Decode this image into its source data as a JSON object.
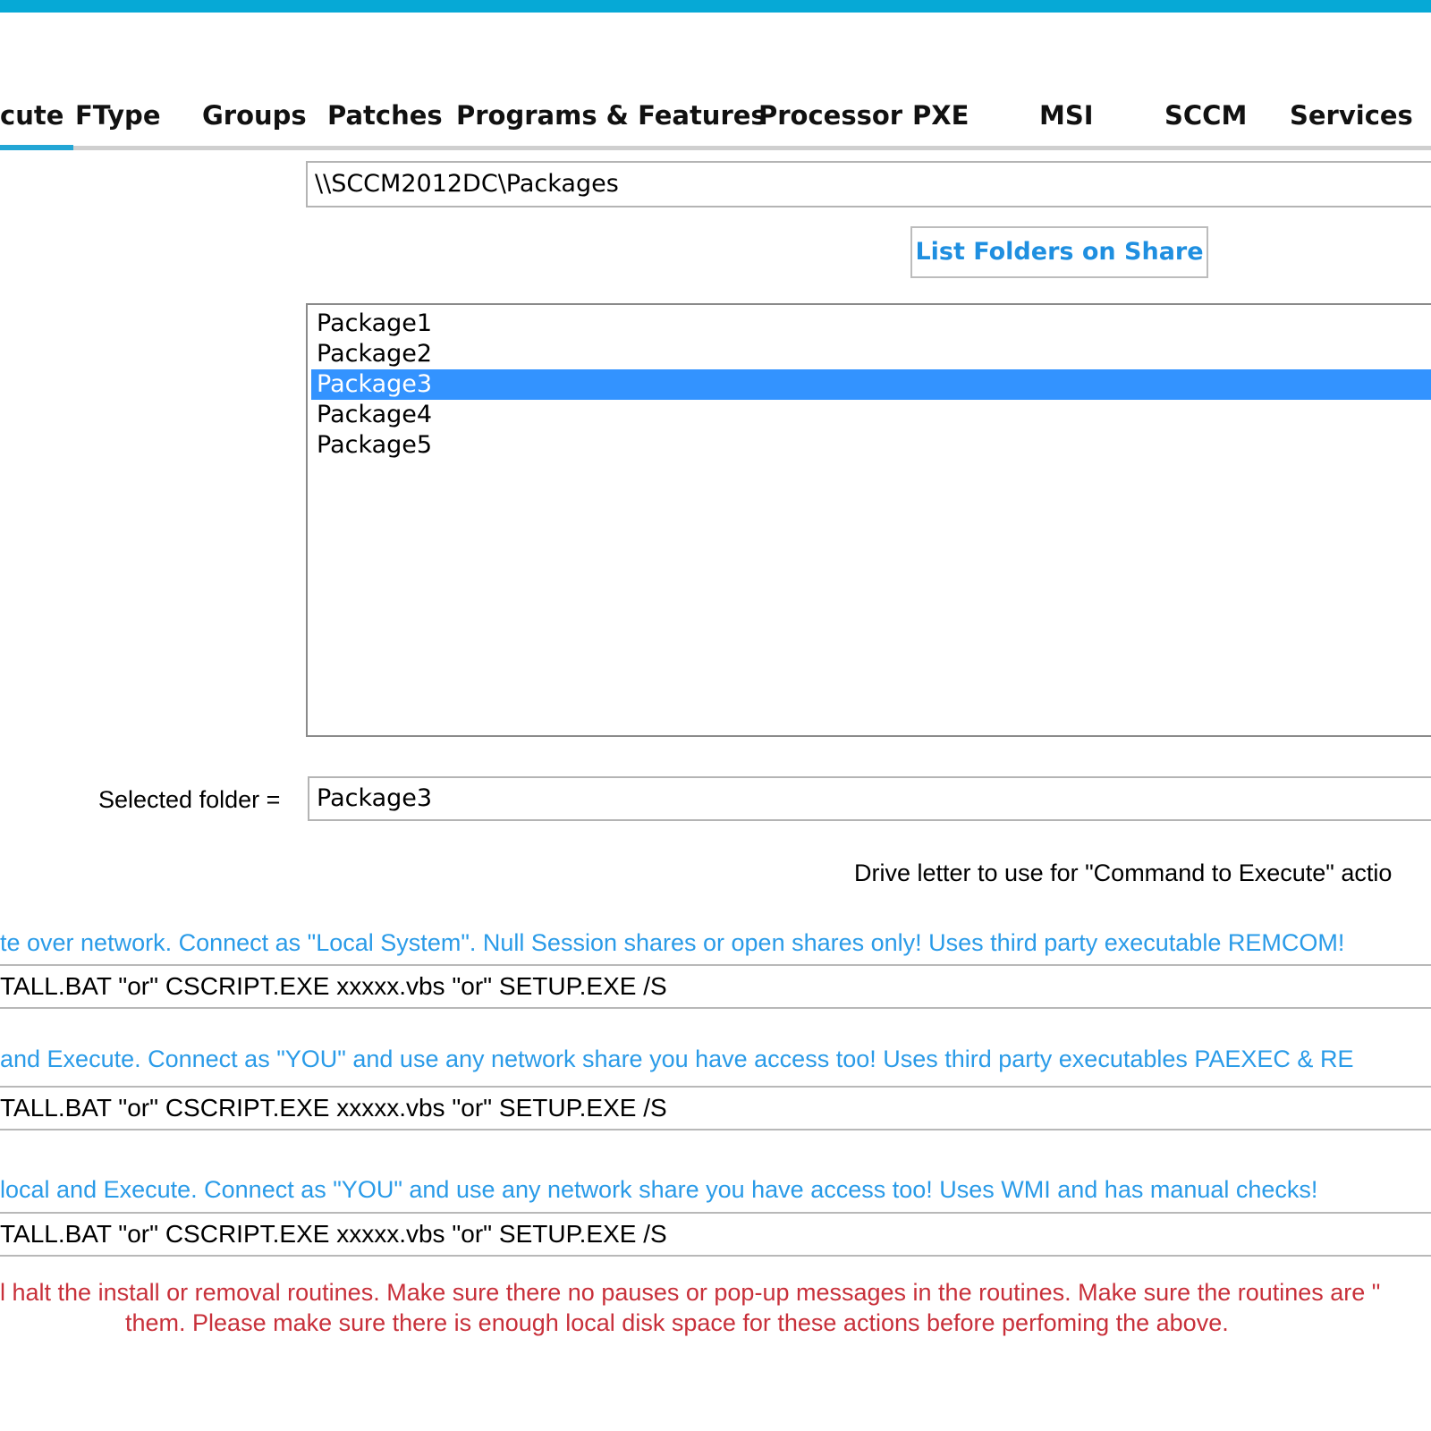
{
  "tabs": [
    {
      "label": "cute"
    },
    {
      "label": "FType"
    },
    {
      "label": "Groups"
    },
    {
      "label": "Patches"
    },
    {
      "label": "Programs & Features"
    },
    {
      "label": "Processor"
    },
    {
      "label": "PXE"
    },
    {
      "label": "MSI"
    },
    {
      "label": "SCCM"
    },
    {
      "label": "Services"
    }
  ],
  "share": {
    "path_value": "\\\\SCCM2012DC\\Packages",
    "list_button_label": "List Folders on Share"
  },
  "folders": {
    "items": [
      "Package1",
      "Package2",
      "Package3",
      "Package4",
      "Package5"
    ],
    "selected": "Package3"
  },
  "selected_folder": {
    "label": "Selected folder =",
    "value": "Package3"
  },
  "drive_letter_label": "Drive letter to use for \"Command to Execute\" actio",
  "methods": [
    {
      "note": "te over network. Connect as \"Local System\". Null Session shares or open shares only! Uses third party executable REMCOM!",
      "command": "TALL.BAT \"or\" CSCRIPT.EXE xxxxx.vbs \"or\" SETUP.EXE /S"
    },
    {
      "note": "and Execute. Connect as \"YOU\" and use any network share you have access too! Uses third party executables PAEXEC & RE",
      "command": "TALL.BAT \"or\" CSCRIPT.EXE xxxxx.vbs \"or\" SETUP.EXE /S"
    },
    {
      "note": "local and Execute. Connect as \"YOU\" and use any network share you have access too! Uses WMI and has manual checks!",
      "command": "TALL.BAT \"or\" CSCRIPT.EXE xxxxx.vbs \"or\" SETUP.EXE /S"
    }
  ],
  "warning": {
    "line1": "l halt the install or removal routines. Make sure there no pauses or pop-up messages in the routines. Make sure the routines are \"",
    "line2": "them. Please make sure there is enough local disk space for these actions before perfoming the above."
  },
  "colors": {
    "accent_bar": "#06a9d6",
    "selection": "#3393ff",
    "note_blue": "#2a9be8",
    "warning_red": "#c8303a",
    "button_text": "#1f8fe0"
  }
}
